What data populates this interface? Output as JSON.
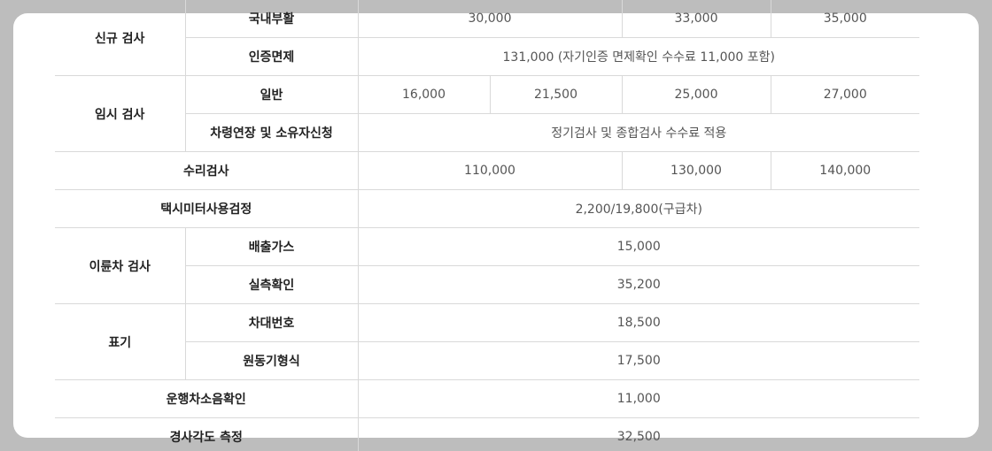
{
  "fee_table": {
    "rows": [
      {
        "group": "신규 검사",
        "item": "국내부활",
        "values": [
          "30,000",
          "33,000",
          "35,000"
        ]
      },
      {
        "item": "인증면제",
        "value": "131,000 (자기인증 면제확인 수수료 11,000 포함)"
      },
      {
        "group": "임시 검사",
        "item": "일반",
        "values": [
          "16,000",
          "21,500",
          "25,000",
          "27,000"
        ]
      },
      {
        "item": "차령연장 및 소유자신청",
        "value": "정기검사 및 종합검사 수수료 적용"
      },
      {
        "label": "수리검사",
        "values": [
          "110,000",
          "130,000",
          "140,000"
        ]
      },
      {
        "label": "택시미터사용검정",
        "value": "2,200/19,800(구급차)"
      },
      {
        "group": "이륜차 검사",
        "item": "배출가스",
        "value": "15,000"
      },
      {
        "item": "실측확인",
        "value": "35,200"
      },
      {
        "group": "표기",
        "item": "차대번호",
        "value": "18,500"
      },
      {
        "item": "원동기형식",
        "value": "17,500"
      },
      {
        "label": "운행차소음확인",
        "value": "11,000"
      },
      {
        "label": "경사각도 측정",
        "value": "32,500"
      }
    ]
  }
}
